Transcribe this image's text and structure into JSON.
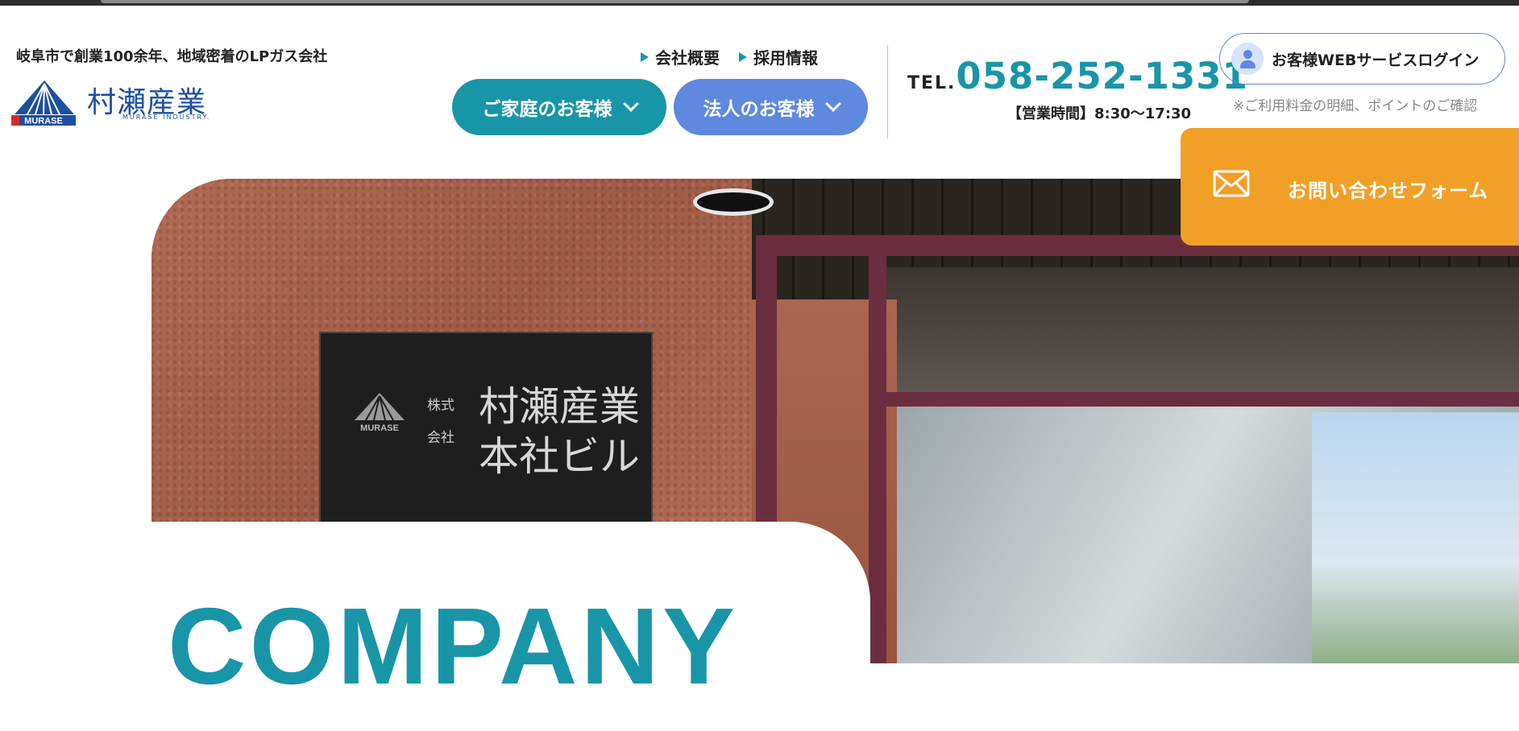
{
  "header": {
    "tagline": "岐阜市で創業100余年、地域密着のLPガス会社",
    "logo": {
      "name": "村瀬産業",
      "sub": "MURASE INDUSTRY.",
      "mark": "MURASE"
    },
    "sublinks": [
      {
        "label": "会社概要"
      },
      {
        "label": "採用情報"
      }
    ],
    "nav": [
      {
        "label": "ご家庭のお客様"
      },
      {
        "label": "法人のお客様"
      }
    ],
    "tel": {
      "label": "TEL.",
      "number": "058-252-1331",
      "hours": "【営業時間】8:30〜17:30"
    },
    "login": {
      "label": "お客様WEBサービスログイン",
      "note": "※ご利用料金の明細、ポイントのご確認"
    }
  },
  "hero": {
    "title": "COMPANY",
    "plaque": {
      "mark": "MURASE",
      "small": "株式会社",
      "main_line1": "村瀬産業",
      "main_line2": "本社ビル"
    }
  },
  "contact": {
    "label": "お問い合わせフォーム"
  },
  "colors": {
    "teal": "#1995a8",
    "blue": "#5f88df",
    "orange": "#f29f27",
    "navy": "#1d4fa0"
  }
}
